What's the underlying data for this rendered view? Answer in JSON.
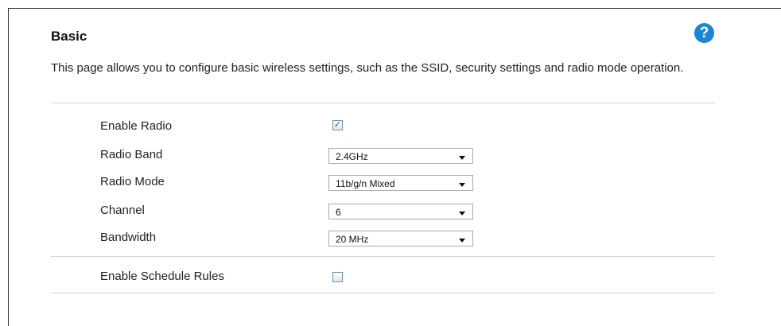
{
  "page": {
    "title": "Basic",
    "description": "This page allows you to configure basic wireless settings, such as the SSID, security settings and radio mode operation.",
    "help_icon": "?"
  },
  "form": {
    "enable_radio": {
      "label": "Enable Radio",
      "checked": true,
      "check_glyph": "✓"
    },
    "radio_band": {
      "label": "Radio Band",
      "value": "2.4GHz"
    },
    "radio_mode": {
      "label": "Radio Mode",
      "value": "11b/g/n Mixed"
    },
    "channel": {
      "label": "Channel",
      "value": "6"
    },
    "bandwidth": {
      "label": "Bandwidth",
      "value": "20 MHz"
    },
    "enable_schedule_rules": {
      "label": "Enable Schedule Rules",
      "checked": false
    }
  },
  "colors": {
    "accent": "#1c86d6"
  }
}
